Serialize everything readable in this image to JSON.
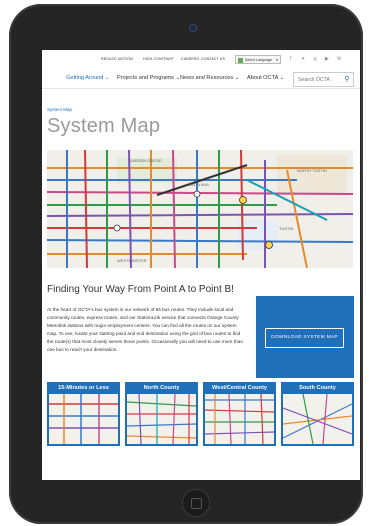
{
  "utility_bar": {
    "links": [
      "REDUCE MOTION",
      "HIGH CONTRAST",
      "CAREERS",
      "CONTACT US"
    ],
    "language_select": "Select Language",
    "social_icons": [
      "facebook-icon",
      "twitter-icon",
      "instagram-icon",
      "youtube-icon",
      "email-icon"
    ]
  },
  "nav": {
    "items": [
      "Getting Around",
      "Projects and Programs",
      "News and Resources",
      "About OCTA"
    ],
    "active_item": "Getting Around",
    "search_placeholder": "Search OCTA"
  },
  "breadcrumb": "System Map",
  "page_title": "System Map",
  "map_labels": [
    "GARDEN GROVE",
    "SANTA ANA",
    "NORTH TUSTIN",
    "TUSTIN",
    "WESTMINSTER"
  ],
  "section": {
    "heading": "Finding Your Way From Point A to Point B!",
    "body": "At the heart of OCTA's bus system is our network of 65 bus routes. They include local and community routes, express routes, and our StationLink service that connects Orange County Metrolink stations with major employment centers. You can find all the routes on our system map. To use, locate your starting point and end destination using the grid of bus routes to find the route(s) that most closely serves those points. Occasionally you will need to use more than one bus to reach your destination."
  },
  "cta": {
    "button_label": "DOWNLOAD SYSTEM MAP"
  },
  "map_cards": [
    "15-Minutes or Less",
    "North County",
    "West/Central County",
    "South County"
  ],
  "colors": {
    "accent_blue": "#1f6fb9",
    "title_gray": "#9a9a9a",
    "device_frame": "#252525"
  }
}
